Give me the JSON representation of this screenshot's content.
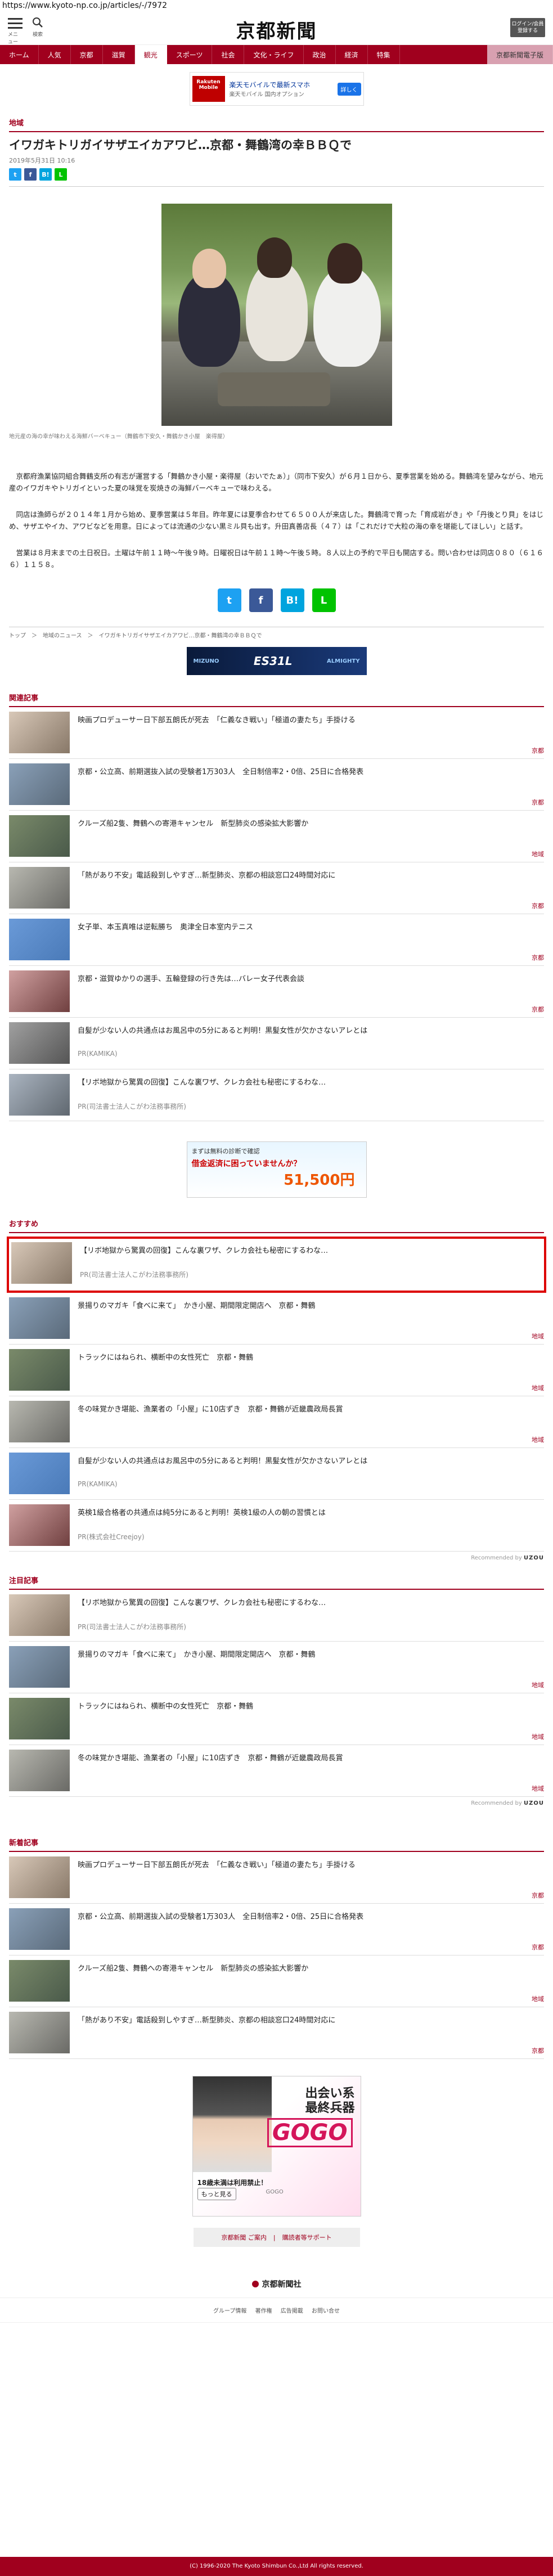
{
  "url": "https://www.kyoto-np.co.jp/articles/-/7972",
  "header": {
    "menu_label": "メニュー",
    "search_label": "検索",
    "logo": "京都新聞",
    "login_label": "ログイン/会員\n登録する"
  },
  "nav": {
    "items": [
      "ホーム",
      "人気",
      "京都",
      "滋賀",
      "観光",
      "スポーツ",
      "社会",
      "文化・ライフ",
      "政治",
      "経済",
      "特集"
    ],
    "special": "京都新聞電子版"
  },
  "ad_top": {
    "brand": "Rakuten Mobile",
    "text": "楽天モバイルで最新スマホ",
    "sub": "楽天モバイル 国内オプション",
    "cta": "詳しく"
  },
  "article": {
    "category": "地域",
    "title": "イワガキトリガイサザエイカアワビ…京都・舞鶴湾の幸ＢＢＱで",
    "date": "2019年5月31日 10:16",
    "photo_caption": "地元産の海の幸が味わえる海鮮バーベキュー（舞鶴市下安久・舞鶴かき小屋　楽得屋）",
    "paragraphs": [
      "京都府漁業協同組合舞鶴支所の有志が運営する「舞鶴かき小屋・楽得屋（おいでたぁ）」（同市下安久）が６月１日から、夏季営業を始める。舞鶴湾を望みながら、地元産のイワガキやトリガイといった夏の味覚を炭焼きの海鮮バーベキューで味わえる。",
      "同店は漁師らが２０１４年１月から始め、夏季営業は５年目。昨年夏には夏季合わせて６５００人が来店した。舞鶴湾で育った「育成岩がき」や「丹後とり貝」をはじめ、サザエやイカ、アワビなどを用意。日によっては流通の少ない黒ミル貝も出す。升田真善店長（４７）は「これだけで大粒の海の幸を堪能してほしい」と話す。",
      "営業は８月末までの土日祝日。土曜は午前１１時～午後９時。日曜祝日は午前１１時～午後５時。８人以上の予約で平日も開店する。問い合わせは同店０８０（６１６６）１１５８。"
    ],
    "breadcrumb": "トップ　＞　地域のニュース　＞　イワガキトリガイサザエイカアワビ…京都・舞鶴湾の幸ＢＢＱで"
  },
  "ad_banner": {
    "brand": "MIZUNO",
    "product": "ES31L",
    "sub": "ALMIGHTY"
  },
  "related": {
    "label": "関連記事",
    "items": [
      {
        "title": "映画プロデューサー日下部五朗氏が死去　「仁義なき戦い」「極道の妻たち」手掛ける",
        "tag": "京都",
        "pr": ""
      },
      {
        "title": "京都・公立高、前期選抜入試の受験者1万303人　全日制倍率2・0倍、25日に合格発表",
        "tag": "京都",
        "pr": ""
      },
      {
        "title": "クルーズ船2隻、舞鶴への寄港キャンセル　新型肺炎の感染拡大影響か",
        "tag": "地域",
        "pr": ""
      },
      {
        "title": "「熱があり不安」電話殺到しやすぎ…新型肺炎、京都の相談窓口24時間対応に",
        "tag": "京都",
        "pr": ""
      },
      {
        "title": "女子単、本玉真唯は逆転勝ち　奥津全日本室内テニス",
        "tag": "京都",
        "pr": ""
      },
      {
        "title": "京都・滋賀ゆかりの選手、五輪登録の行き先は…バレー女子代表会談",
        "tag": "京都",
        "pr": ""
      },
      {
        "title": "自髪が少ない人の共通点はお風呂中の5分にあると判明！黒髪女性が欠かさないアレとは",
        "tag": "",
        "pr": "PR(KAMIKA)"
      },
      {
        "title": "【リボ地獄から驚異の回復】こんな裏ワザ、クレカ会社も秘密にするわな…",
        "tag": "",
        "pr": "PR(司法書士法人こがわ法務事務所)"
      }
    ]
  },
  "ad_mid": {
    "line1": "まずは無料の診断で確認",
    "line2": "借金返済に困っていませんか？",
    "line3": "51,500円"
  },
  "recommend": {
    "label": "おすすめ",
    "items": [
      {
        "title": "【リボ地獄から驚異の回復】こんな裏ワザ、クレカ会社も秘密にするわな…",
        "tag": "",
        "pr": "PR(司法書士法人こがわ法務事務所)"
      },
      {
        "title": "景揚りのマガキ「食べに来て」　かき小屋、期間限定開店へ　京都・舞鶴",
        "tag": "地域",
        "pr": ""
      },
      {
        "title": "トラックにはねられ、横断中の女性死亡　京都・舞鶴",
        "tag": "地域",
        "pr": ""
      },
      {
        "title": "冬の味覚かき堪能、漁業者の「小屋」に10店ずき　京都・舞鶴が近畿農政局長賞",
        "tag": "地域",
        "pr": ""
      },
      {
        "title": "自髪が少ない人の共通点はお風呂中の5分にあると判明！黒髪女性が欠かさないアレとは",
        "tag": "",
        "pr": "PR(KAMIKA)"
      },
      {
        "title": "英検1級合格者の共通点は純5分にあると判明！英検1級の人の朝の習慣とは",
        "tag": "",
        "pr": "PR(株式会社Creejoy)"
      }
    ],
    "footer": "Recommended by"
  },
  "attention": {
    "label": "注目記事",
    "items": [
      {
        "title": "【リボ地獄から驚異の回復】こんな裏ワザ、クレカ会社も秘密にするわな…",
        "tag": "",
        "pr": "PR(司法書士法人こがわ法務事務所)"
      },
      {
        "title": "景揚りのマガキ「食べに来て」　かき小屋、期間限定開店へ　京都・舞鶴",
        "tag": "地域",
        "pr": ""
      },
      {
        "title": "トラックにはねられ、横断中の女性死亡　京都・舞鶴",
        "tag": "地域",
        "pr": ""
      },
      {
        "title": "冬の味覚かき堪能、漁業者の「小屋」に10店ずき　京都・舞鶴が近畿農政局長賞",
        "tag": "地域",
        "pr": ""
      }
    ],
    "footer": "Recommended by"
  },
  "latest": {
    "label": "新着記事",
    "items": [
      {
        "title": "映画プロデューサー日下部五朗氏が死去　「仁義なき戦い」「極道の妻たち」手掛ける",
        "tag": "京都",
        "pr": ""
      },
      {
        "title": "京都・公立高、前期選抜入試の受験者1万303人　全日制倍率2・0倍、25日に合格発表",
        "tag": "京都",
        "pr": ""
      },
      {
        "title": "クルーズ船2隻、舞鶴への寄港キャンセル　新型肺炎の感染拡大影響か",
        "tag": "地域",
        "pr": ""
      },
      {
        "title": "「熱があり不安」電話殺到しやすぎ…新型肺炎、京都の相談窓口24時間対応に",
        "tag": "京都",
        "pr": ""
      }
    ]
  },
  "ad_gogo": {
    "line1": "出会い系\n最終兵器",
    "brand": "GOGO",
    "note": "18歳未満は利用禁止！",
    "cta": "もっと見る",
    "small": "GOGO"
  },
  "footer": {
    "links": [
      "京都新聞 ご案内",
      "購読者等サポート"
    ],
    "logo": "京都新聞社",
    "nav": [
      "グループ情報",
      "著作権",
      "広告掲載",
      "お問い合せ"
    ],
    "copyright": "(C) 1996-2020 The Kyoto Shimbun Co.,Ltd All rights reserved."
  },
  "colors": {
    "brand": "#a0001e",
    "highlight": "#dd0000"
  }
}
